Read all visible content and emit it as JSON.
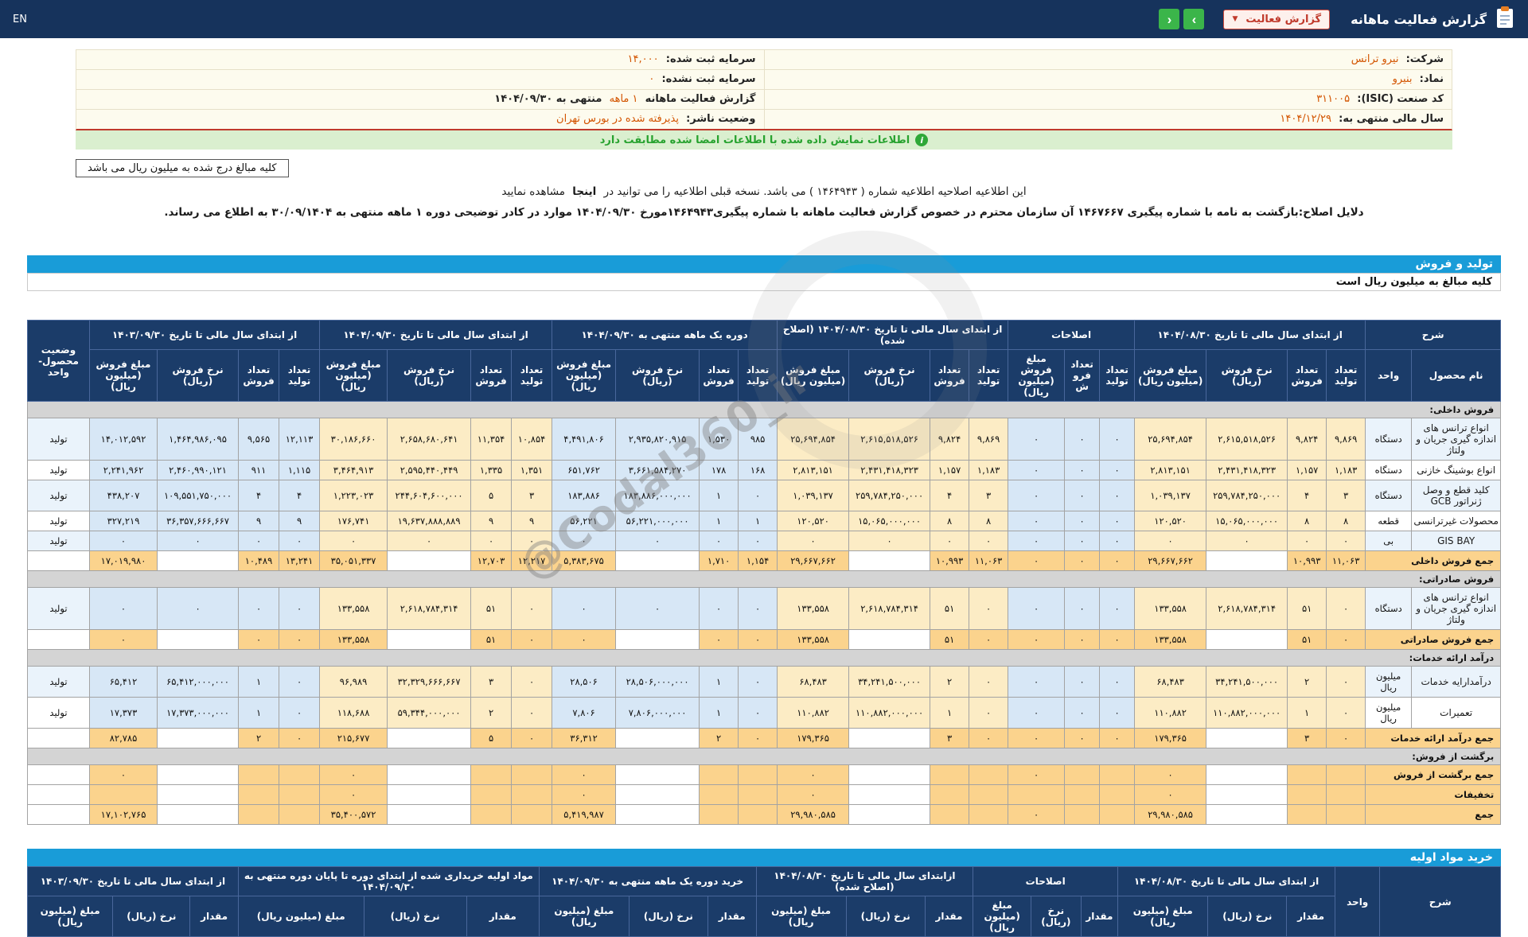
{
  "topbar": {
    "title": "گزارش فعالیت ماهانه",
    "report_type_label": "گزارش فعالیت",
    "next_arrow": "›",
    "prev_arrow": "‹",
    "lang": "EN"
  },
  "company_info": {
    "rows": [
      {
        "r_label": "شرکت:",
        "r_value": "نیرو ترانس",
        "l_label": "سرمایه ثبت شده:",
        "l_value": "۱۴,۰۰۰",
        "l_suffix": ""
      },
      {
        "r_label": "نماد:",
        "r_value": "بنیرو",
        "l_label": "سرمایه ثبت نشده:",
        "l_value": "۰",
        "l_suffix": ""
      },
      {
        "r_label": "کد صنعت (ISIC):",
        "r_value": "۳۱۱۰۰۵",
        "l_label": "گزارش فعالیت ماهانه",
        "l_value": "۱ ماهه",
        "l_suffix": "منتهی به ۱۴۰۴/۰۹/۳۰"
      },
      {
        "r_label": "سال مالی منتهی به:",
        "r_value": "۱۴۰۴/۱۲/۲۹",
        "l_label": "وضعیت ناشر:",
        "l_value": "پذیرفته شده در بورس تهران",
        "l_suffix": ""
      }
    ],
    "match_banner": "اطلاعات نمایش داده شده با اطلاعات امضا شده مطابقت دارد",
    "info_icon": "i"
  },
  "notes": {
    "amounts_box": "کلیه مبالغ درج شده به میلیون ریال می باشد",
    "amendment_pre": "این اطلاعیه اصلاحیه اطلاعیه شماره ( ۱۴۶۴۹۴۳ ) می باشد. نسخه قبلی اطلاعیه را می توانید در",
    "amendment_link": "اینجا",
    "amendment_post": "مشاهده نمایید",
    "reason_line": "دلایل اصلاح:بازگشت به نامه با شماره پیگیری ۱۴۶۷۶۶۷ آن سازمان محترم در خصوص گزارش فعالیت ماهانه با شماره پیگیری۱۴۶۴۹۴۳مورخ ۱۴۰۴/۰۹/۳۰ موارد در کادر توضیحی دوره ۱ ماهه منتهی به ۳۰/۰۹/۱۴۰۴ به اطلاع می رساند."
  },
  "watermark": "@Codal360_ir",
  "sales_table": {
    "bar_title": "تولید و فروش",
    "note": "کلیه مبالغ به میلیون ریال است",
    "desc_header": "شرح",
    "name_header": "نام محصول",
    "unit_header": "واحد",
    "status_header": "وضعیت محصول-واحد",
    "groups": [
      {
        "label": "از ابتدای سال مالی تا تاریخ ۱۴۰۴/۰۸/۳۰",
        "sub": [
          "تعداد تولید",
          "تعداد فروش",
          "نرخ فروش (ریال)",
          "مبلغ فروش (میلیون ریال)"
        ]
      },
      {
        "label": "اصلاحات",
        "sub": [
          "تعداد تولید",
          "تعداد فروش",
          "مبلغ فروش (میلیون ریال)"
        ]
      },
      {
        "label": "از ابتدای سال مالی تا تاریخ ۱۴۰۴/۰۸/۳۰ (اصلاح شده)",
        "sub": [
          "تعداد تولید",
          "تعداد فروش",
          "نرخ فروش (ریال)",
          "مبلغ فروش (میلیون ریال)"
        ]
      },
      {
        "label": "دوره یک ماهه منتهی به ۱۴۰۴/۰۹/۳۰",
        "sub": [
          "تعداد تولید",
          "تعداد فروش",
          "نرخ فروش (ریال)",
          "مبلغ فروش (میلیون ریال)"
        ]
      },
      {
        "label": "از ابتدای سال مالی تا تاریخ ۱۴۰۴/۰۹/۳۰",
        "sub": [
          "تعداد تولید",
          "تعداد فروش",
          "نرخ فروش (ریال)",
          "مبلغ فروش (میلیون ریال)"
        ]
      },
      {
        "label": "از ابتدای سال مالی تا تاریخ ۱۴۰۳/۰۹/۳۰",
        "sub": [
          "تعداد تولید",
          "تعداد فروش",
          "نرخ فروش (ریال)",
          "مبلغ فروش (میلیون ریال)"
        ]
      }
    ],
    "rows": [
      {
        "type": "section",
        "label": "فروش داخلی:"
      },
      {
        "type": "data",
        "name": "انواع ترانس های اندازه گیری جریان و ولتاژ",
        "unit": "دستگاه",
        "status": "تولید",
        "cells": [
          "۹,۸۶۹",
          "۹,۸۲۴",
          "۲,۶۱۵,۵۱۸,۵۲۶",
          "۲۵,۶۹۴,۸۵۴",
          "۰",
          "۰",
          "۰",
          "۹,۸۶۹",
          "۹,۸۲۴",
          "۲,۶۱۵,۵۱۸,۵۲۶",
          "۲۵,۶۹۴,۸۵۴",
          "۹۸۵",
          "۱,۵۳۰",
          "۲,۹۳۵,۸۲۰,۹۱۵",
          "۴,۴۹۱,۸۰۶",
          "۱۰,۸۵۴",
          "۱۱,۳۵۴",
          "۲,۶۵۸,۶۸۰,۶۴۱",
          "۳۰,۱۸۶,۶۶۰",
          "۱۲,۱۱۳",
          "۹,۵۶۵",
          "۱,۴۶۴,۹۸۶,۰۹۵",
          "۱۴,۰۱۲,۵۹۲"
        ]
      },
      {
        "type": "data",
        "name": "انواع بوشینگ خازنی",
        "unit": "دستگاه",
        "status": "تولید",
        "cells": [
          "۱,۱۸۳",
          "۱,۱۵۷",
          "۲,۴۳۱,۴۱۸,۳۲۳",
          "۲,۸۱۳,۱۵۱",
          "۰",
          "۰",
          "۰",
          "۱,۱۸۳",
          "۱,۱۵۷",
          "۲,۴۳۱,۴۱۸,۳۲۳",
          "۲,۸۱۳,۱۵۱",
          "۱۶۸",
          "۱۷۸",
          "۳,۶۶۱,۵۸۴,۲۷۰",
          "۶۵۱,۷۶۲",
          "۱,۳۵۱",
          "۱,۳۳۵",
          "۲,۵۹۵,۴۴۰,۴۴۹",
          "۳,۴۶۴,۹۱۳",
          "۱,۱۱۵",
          "۹۱۱",
          "۲,۴۶۰,۹۹۰,۱۲۱",
          "۲,۲۴۱,۹۶۲"
        ]
      },
      {
        "type": "data",
        "name": "کلید قطع و وصل ژنراتور GCB",
        "unit": "دستگاه",
        "status": "تولید",
        "cells": [
          "۳",
          "۴",
          "۲۵۹,۷۸۴,۲۵۰,۰۰۰",
          "۱,۰۳۹,۱۳۷",
          "۰",
          "۰",
          "۰",
          "۳",
          "۴",
          "۲۵۹,۷۸۴,۲۵۰,۰۰۰",
          "۱,۰۳۹,۱۳۷",
          "۰",
          "۱",
          "۱۸۳,۸۸۶,۰۰۰,۰۰۰",
          "۱۸۳,۸۸۶",
          "۳",
          "۵",
          "۲۴۴,۶۰۴,۶۰۰,۰۰۰",
          "۱,۲۲۳,۰۲۳",
          "۴",
          "۴",
          "۱۰۹,۵۵۱,۷۵۰,۰۰۰",
          "۴۳۸,۲۰۷"
        ]
      },
      {
        "type": "data",
        "name": "محصولات غیرترانسی",
        "unit": "قطعه",
        "status": "تولید",
        "cells": [
          "۸",
          "۸",
          "۱۵,۰۶۵,۰۰۰,۰۰۰",
          "۱۲۰,۵۲۰",
          "۰",
          "۰",
          "۰",
          "۸",
          "۸",
          "۱۵,۰۶۵,۰۰۰,۰۰۰",
          "۱۲۰,۵۲۰",
          "۱",
          "۱",
          "۵۶,۲۲۱,۰۰۰,۰۰۰",
          "۵۶,۲۲۱",
          "۹",
          "۹",
          "۱۹,۶۳۷,۸۸۸,۸۸۹",
          "۱۷۶,۷۴۱",
          "۹",
          "۹",
          "۳۶,۳۵۷,۶۶۶,۶۶۷",
          "۳۲۷,۲۱۹"
        ]
      },
      {
        "type": "data",
        "name": "GIS BAY",
        "unit": "بی",
        "status": "تولید",
        "cells": [
          "۰",
          "۰",
          "۰",
          "۰",
          "۰",
          "۰",
          "۰",
          "۰",
          "۰",
          "۰",
          "۰",
          "۰",
          "۰",
          "۰",
          "۰",
          "۰",
          "۰",
          "۰",
          "۰",
          "۰",
          "۰",
          "۰",
          "۰"
        ]
      },
      {
        "type": "total",
        "label": "جمع فروش داخلی",
        "status": "",
        "cells": [
          "۱۱,۰۶۳",
          "۱۰,۹۹۳",
          "",
          "۲۹,۶۶۷,۶۶۲",
          "۰",
          "۰",
          "۰",
          "۱۱,۰۶۳",
          "۱۰,۹۹۳",
          "",
          "۲۹,۶۶۷,۶۶۲",
          "۱,۱۵۴",
          "۱,۷۱۰",
          "",
          "۵,۳۸۳,۶۷۵",
          "۱۲,۲۱۷",
          "۱۲,۷۰۳",
          "",
          "۳۵,۰۵۱,۳۳۷",
          "۱۳,۲۴۱",
          "۱۰,۴۸۹",
          "",
          "۱۷,۰۱۹,۹۸۰"
        ]
      },
      {
        "type": "section",
        "label": "فروش صادراتی:"
      },
      {
        "type": "data",
        "name": "انواع ترانس های اندازه گیری جریان و ولتاژ",
        "unit": "دستگاه",
        "status": "تولید",
        "cells": [
          "۰",
          "۵۱",
          "۲,۶۱۸,۷۸۴,۳۱۴",
          "۱۳۳,۵۵۸",
          "۰",
          "۰",
          "۰",
          "۰",
          "۵۱",
          "۲,۶۱۸,۷۸۴,۳۱۴",
          "۱۳۳,۵۵۸",
          "۰",
          "۰",
          "۰",
          "۰",
          "۰",
          "۵۱",
          "۲,۶۱۸,۷۸۴,۳۱۴",
          "۱۳۳,۵۵۸",
          "۰",
          "۰",
          "۰",
          "۰"
        ]
      },
      {
        "type": "total",
        "label": "جمع فروش صادراتی",
        "status": "",
        "cells": [
          "۰",
          "۵۱",
          "",
          "۱۳۳,۵۵۸",
          "۰",
          "۰",
          "۰",
          "۰",
          "۵۱",
          "",
          "۱۳۳,۵۵۸",
          "۰",
          "۰",
          "",
          "۰",
          "۰",
          "۵۱",
          "",
          "۱۳۳,۵۵۸",
          "۰",
          "۰",
          "",
          "۰"
        ]
      },
      {
        "type": "section",
        "label": "درآمد ارائه خدمات:"
      },
      {
        "type": "data",
        "name": "درآمدارایه خدمات",
        "unit": "میلیون ریال",
        "status": "تولید",
        "cells": [
          "۰",
          "۲",
          "۳۴,۲۴۱,۵۰۰,۰۰۰",
          "۶۸,۴۸۳",
          "۰",
          "۰",
          "۰",
          "۰",
          "۲",
          "۳۴,۲۴۱,۵۰۰,۰۰۰",
          "۶۸,۴۸۳",
          "۰",
          "۱",
          "۲۸,۵۰۶,۰۰۰,۰۰۰",
          "۲۸,۵۰۶",
          "۰",
          "۳",
          "۳۲,۳۲۹,۶۶۶,۶۶۷",
          "۹۶,۹۸۹",
          "۰",
          "۱",
          "۶۵,۴۱۲,۰۰۰,۰۰۰",
          "۶۵,۴۱۲"
        ]
      },
      {
        "type": "data",
        "name": "تعمیرات",
        "unit": "میلیون ریال",
        "status": "تولید",
        "cells": [
          "۰",
          "۱",
          "۱۱۰,۸۸۲,۰۰۰,۰۰۰",
          "۱۱۰,۸۸۲",
          "۰",
          "۰",
          "۰",
          "۰",
          "۱",
          "۱۱۰,۸۸۲,۰۰۰,۰۰۰",
          "۱۱۰,۸۸۲",
          "۰",
          "۱",
          "۷,۸۰۶,۰۰۰,۰۰۰",
          "۷,۸۰۶",
          "۰",
          "۲",
          "۵۹,۳۴۴,۰۰۰,۰۰۰",
          "۱۱۸,۶۸۸",
          "۰",
          "۱",
          "۱۷,۳۷۳,۰۰۰,۰۰۰",
          "۱۷,۳۷۳"
        ]
      },
      {
        "type": "total",
        "label": "جمع درآمد ارائه خدمات",
        "status": "",
        "cells": [
          "۰",
          "۳",
          "",
          "۱۷۹,۳۶۵",
          "۰",
          "۰",
          "۰",
          "۰",
          "۳",
          "",
          "۱۷۹,۳۶۵",
          "۰",
          "۲",
          "",
          "۳۶,۳۱۲",
          "۰",
          "۵",
          "",
          "۲۱۵,۶۷۷",
          "۰",
          "۲",
          "",
          "۸۲,۷۸۵"
        ]
      },
      {
        "type": "section",
        "label": "برگشت از فروش:"
      },
      {
        "type": "total",
        "label": "جمع برگشت از فروش",
        "status": "",
        "cells": [
          "",
          "",
          "",
          "۰",
          "",
          "",
          "۰",
          "",
          "",
          "",
          "۰",
          "",
          "",
          "",
          "۰",
          "",
          "",
          "",
          "۰",
          "",
          "",
          "",
          "۰"
        ]
      },
      {
        "type": "total",
        "label": "تخفیفات",
        "status": "",
        "cells": [
          "",
          "",
          "",
          "۰",
          "",
          "",
          "",
          "",
          "",
          "",
          "۰",
          "",
          "",
          "",
          "۰",
          "",
          "",
          "",
          "۰",
          "",
          "",
          "",
          ""
        ]
      },
      {
        "type": "total",
        "label": "جمع",
        "status": "",
        "cells": [
          "",
          "",
          "",
          "۲۹,۹۸۰,۵۸۵",
          "",
          "",
          "۰",
          "",
          "",
          "",
          "۲۹,۹۸۰,۵۸۵",
          "",
          "",
          "",
          "۵,۴۱۹,۹۸۷",
          "",
          "",
          "",
          "۳۵,۴۰۰,۵۷۲",
          "",
          "",
          "",
          "۱۷,۱۰۲,۷۶۵"
        ]
      }
    ]
  },
  "purchase_table": {
    "bar_title": "خرید مواد اولیه",
    "desc_header": "شرح",
    "unit_header": "واحد",
    "groups": [
      {
        "label": "از ابتدای سال مالی تا تاریخ ۱۴۰۴/۰۸/۳۰",
        "sub": [
          "مقدار",
          "نرخ (ریال)",
          "مبلغ (میلیون ریال)"
        ]
      },
      {
        "label": "اصلاحات",
        "sub": [
          "مقدار",
          "نرخ (ریال)",
          "مبلغ (میلیون ریال)"
        ]
      },
      {
        "label": "ازابتدای سال مالی تا تاریخ ۱۴۰۴/۰۸/۳۰ (اصلاح شده)",
        "sub": [
          "مقدار",
          "نرخ (ریال)",
          "مبلغ (میلیون ریال)"
        ]
      },
      {
        "label": "خرید دوره یک ماهه منتهی به ۱۴۰۴/۰۹/۳۰",
        "sub": [
          "مقدار",
          "نرخ (ریال)",
          "مبلغ (میلیون ریال)"
        ]
      },
      {
        "label": "مواد اولیه خریداری شده از ابتدای دوره تا پایان دوره منتهی به ۱۴۰۴/۰۹/۳۰",
        "sub": [
          "مقدار",
          "نرخ (ریال)",
          "مبلغ (میلیون ریال)"
        ]
      },
      {
        "label": "از ابتدای سال مالی تا تاریخ ۱۴۰۳/۰۹/۳۰",
        "sub": [
          "مقدار",
          "نرخ (ریال)",
          "مبلغ (میلیون ریال)"
        ]
      }
    ]
  }
}
